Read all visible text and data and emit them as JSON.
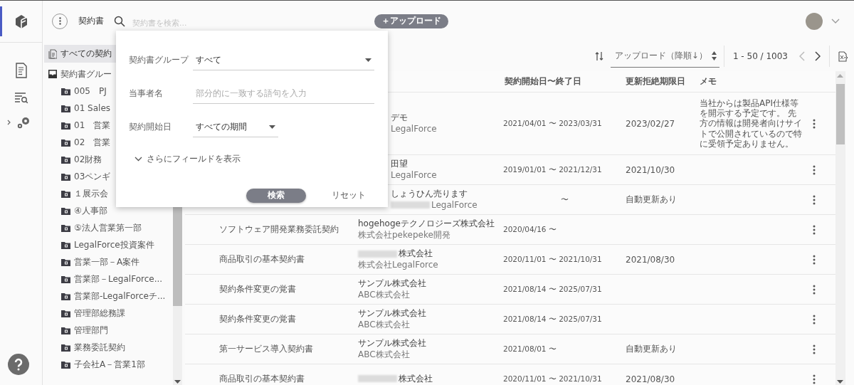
{
  "header": {
    "title": "契約書",
    "search_placeholder": "契約書を検索...",
    "upload_button": "＋アップロード"
  },
  "sidebar": {
    "all_item": {
      "label": "すべての契約",
      "selected": true
    },
    "group": {
      "label": "契約書グルー",
      "children": [
        {
          "label": "005　PJ",
          "selected": false
        },
        {
          "label": "01 Sales",
          "selected": false
        },
        {
          "label": "01　営業",
          "selected": false
        },
        {
          "label": "02　営業",
          "selected": false
        },
        {
          "label": "02財務",
          "selected": false
        },
        {
          "label": "03ペンギ",
          "selected": false
        },
        {
          "label": "１展示会",
          "selected": false
        },
        {
          "label": "④人事部",
          "selected": false
        },
        {
          "label": "⑤法人営業第一部",
          "selected": false
        },
        {
          "label": "LegalForce投資案件",
          "selected": false
        },
        {
          "label": "営業一部－A案件",
          "selected": false
        },
        {
          "label": "営業部－LegalForce...",
          "selected": false
        },
        {
          "label": "営業部-LegalForceチ...",
          "selected": false
        },
        {
          "label": "管理部総務課",
          "selected": false
        },
        {
          "label": "管理部門",
          "selected": false
        },
        {
          "label": "業務委託契約",
          "selected": false
        },
        {
          "label": "子会社A－営業1部",
          "selected": false
        }
      ]
    }
  },
  "toolbar": {
    "sort": "アップロード（降順↓）",
    "range": "1 - 50 / 1003",
    "prev_disabled": true,
    "next_disabled": false
  },
  "table": {
    "columns": [
      "契約開始日〜終了日",
      "更新拒絶期限日",
      "メモ"
    ],
    "rows": [
      {
        "title": "",
        "party": "デモ",
        "party_redacted": false,
        "party_sub": "LegalForce",
        "sub_redacted": false,
        "period": "2021/04/01 〜 2023/03/31",
        "renewal_deadline": "2023/02/27",
        "memo": "当社からは製品API仕様等を開示する予定です。 先方の情報は開発者向けサイトで公開されているので特に受領予定ありません。"
      },
      {
        "title": "",
        "party": "田望",
        "party_redacted": false,
        "party_sub": "LegalForce",
        "sub_redacted": false,
        "period": "2019/01/01 〜 2021/12/31",
        "renewal_deadline": "2021/10/30",
        "memo": ""
      },
      {
        "title": "",
        "party": "しょうひん売ります",
        "party_redacted": false,
        "party_sub": "LegalForce",
        "sub_redacted": true,
        "period": "〜",
        "renewal_deadline": "自動更新あり",
        "memo": ""
      },
      {
        "title": "ソフトウェア開発業務委託契約",
        "party": "hogehogeテクノロジーズ株式会社",
        "party_redacted": false,
        "party_sub": "株式会社pekepeke開発",
        "sub_redacted": false,
        "period": "2020/04/16 〜",
        "renewal_deadline": "",
        "memo": ""
      },
      {
        "title": "商品取引の基本契約書",
        "party": "株式会社",
        "party_redacted": true,
        "party_sub": "株式会社LegalForce",
        "sub_redacted": false,
        "period": "2020/11/01 〜 2021/10/31",
        "renewal_deadline": "2021/08/30",
        "memo": ""
      },
      {
        "title": "契約条件変更の覚書",
        "party": "サンプル株式会社",
        "party_redacted": false,
        "party_sub": "ABC株式会社",
        "sub_redacted": false,
        "period": "2021/08/14 〜 2025/07/31",
        "renewal_deadline": "",
        "memo": ""
      },
      {
        "title": "契約条件変更の覚書",
        "party": "サンプル株式会社",
        "party_redacted": false,
        "party_sub": "ABC株式会社",
        "sub_redacted": false,
        "period": "2021/08/14 〜 2025/07/31",
        "renewal_deadline": "",
        "memo": ""
      },
      {
        "title": "第一サービス導入契約書",
        "party": "サンプル株式会社",
        "party_redacted": false,
        "party_sub": "ABC株式会社",
        "sub_redacted": false,
        "period": "2021/08/01 〜",
        "renewal_deadline": "自動更新あり",
        "memo": ""
      },
      {
        "title": "商品取引の基本契約書",
        "party": "株式会社",
        "party_redacted": true,
        "party_sub": "",
        "sub_redacted": false,
        "period": "2020/11/01 〜 2021/10/31",
        "renewal_deadline": "2021/08/30",
        "memo": ""
      }
    ]
  },
  "search_popup": {
    "fields": [
      {
        "kind": "select",
        "label": "契約書グループ",
        "value": "すべて"
      },
      {
        "kind": "text",
        "label": "当事者名",
        "placeholder": "部分的に一致する語句を入力"
      },
      {
        "kind": "select_short",
        "label": "契約開始日",
        "value": "すべての期間"
      }
    ],
    "more_fields": "さらにフィールドを表示",
    "search_button": "検索",
    "reset_button": "リセット"
  }
}
